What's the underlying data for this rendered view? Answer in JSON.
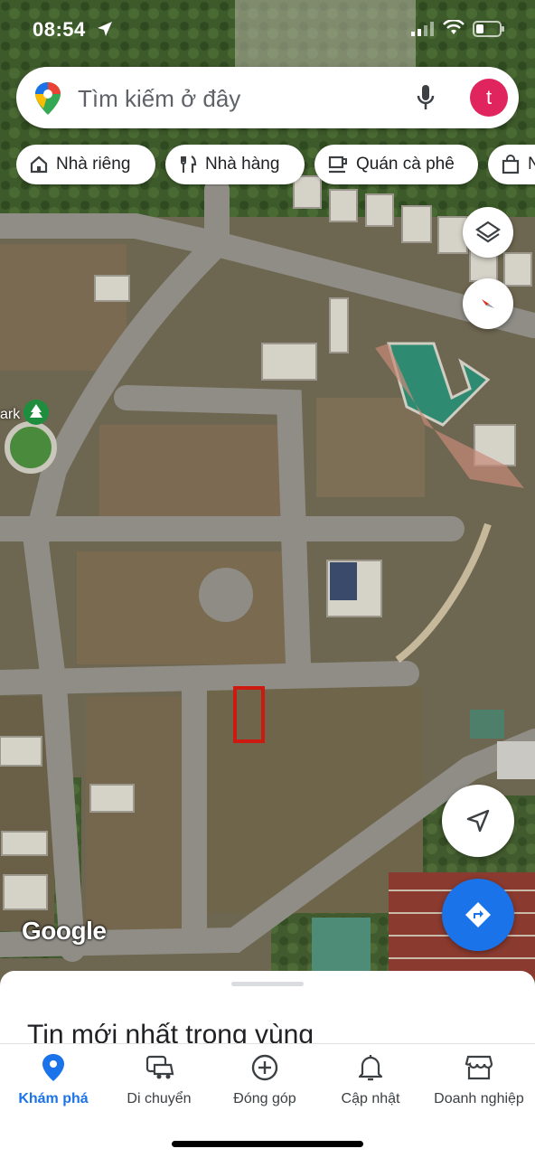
{
  "status_bar": {
    "time": "08:54"
  },
  "search": {
    "placeholder": "Tìm kiếm ở đây",
    "avatar_initial": "t"
  },
  "chips": [
    {
      "label": "Nhà riêng",
      "icon": "home-icon"
    },
    {
      "label": "Nhà hàng",
      "icon": "restaurant-icon"
    },
    {
      "label": "Quán cà phê",
      "icon": "cafe-icon"
    },
    {
      "label": "N",
      "icon": "shopping-bag-icon"
    }
  ],
  "map": {
    "poi_label": "ark",
    "attribution": "Google"
  },
  "sheet": {
    "title": "Tin mới nhất trong vùng"
  },
  "nav": [
    {
      "label": "Khám phá",
      "icon": "explore-pin-icon",
      "active": true
    },
    {
      "label": "Di chuyển",
      "icon": "commute-car-icon",
      "active": false
    },
    {
      "label": "Đóng góp",
      "icon": "contribute-plus-icon",
      "active": false
    },
    {
      "label": "Cập nhật",
      "icon": "bell-icon",
      "active": false
    },
    {
      "label": "Doanh nghiệp",
      "icon": "storefront-icon",
      "active": false
    }
  ],
  "colors": {
    "accent": "#1a73e8",
    "avatar": "#e0245e",
    "marker": "#cc1a10"
  }
}
